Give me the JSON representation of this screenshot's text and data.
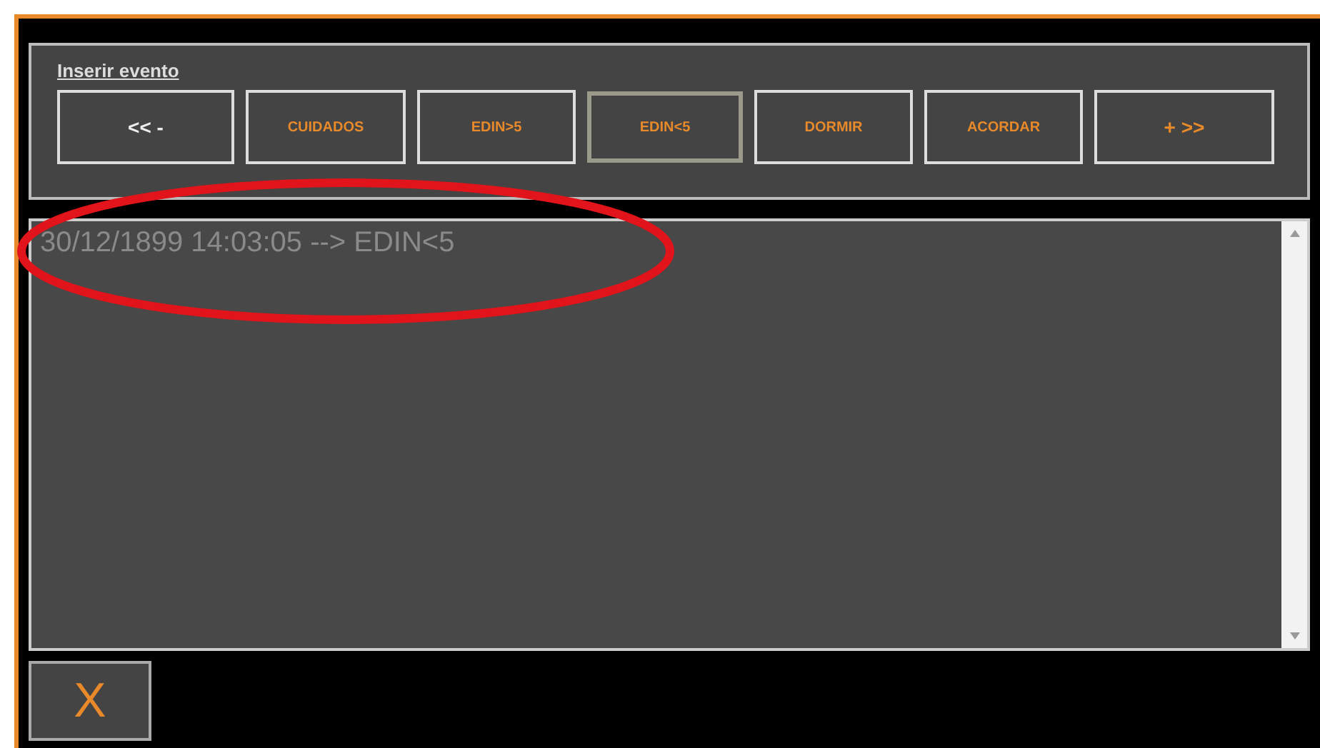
{
  "event_panel": {
    "title": "Inserir evento",
    "buttons": [
      {
        "label": "<< -",
        "kind": "nav",
        "selected": false
      },
      {
        "label": "CUIDADOS",
        "kind": "event",
        "selected": false
      },
      {
        "label": "EDIN>5",
        "kind": "event",
        "selected": false
      },
      {
        "label": "EDIN<5",
        "kind": "event",
        "selected": true
      },
      {
        "label": "DORMIR",
        "kind": "event",
        "selected": false
      },
      {
        "label": "ACORDAR",
        "kind": "event",
        "selected": false
      },
      {
        "label": "+ >>",
        "kind": "nav_accent",
        "selected": false
      }
    ]
  },
  "log": {
    "lines": [
      "30/12/1899 14:03:05 --> EDIN<5"
    ]
  },
  "close_button": {
    "label": "X"
  }
}
